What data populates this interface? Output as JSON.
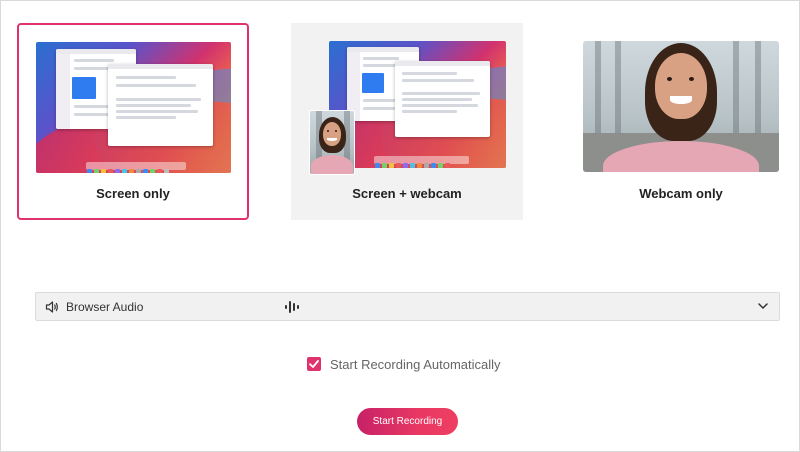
{
  "options": [
    {
      "label": "Screen only",
      "selected": true
    },
    {
      "label": "Screen + webcam",
      "selected": false
    },
    {
      "label": "Webcam only",
      "selected": false
    }
  ],
  "audio": {
    "selected": "Browser Audio",
    "icon": "speaker-icon",
    "meter_icon": "audio-level-icon",
    "dropdown_icon": "chevron-down-icon"
  },
  "auto_start": {
    "label": "Start Recording Automatically",
    "checked": true
  },
  "start_button": {
    "label": "Start Recording"
  },
  "colors": {
    "accent": "#e0336e",
    "button_gradient_start": "#c72167",
    "button_gradient_end": "#ee3f62"
  }
}
